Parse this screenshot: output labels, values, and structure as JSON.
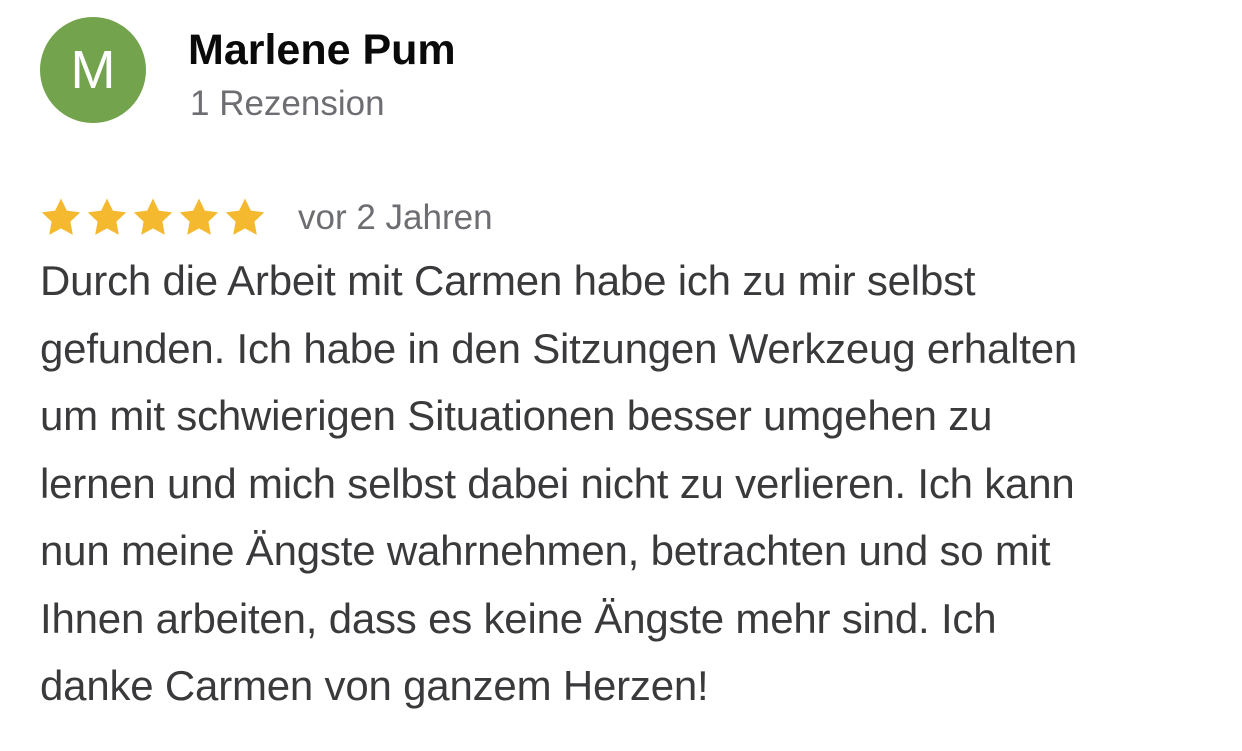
{
  "reviewer": {
    "initial": "M",
    "name": "Marlene Pum",
    "review_count": "1 Rezension",
    "avatar_color": "#73a34c"
  },
  "review": {
    "rating": 5,
    "rating_max": 5,
    "star_color": "#f4b92f",
    "date": "vor 2 Jahren",
    "lines": [
      "Durch die Arbeit mit Carmen habe ich zu mir selbst",
      "gefunden. Ich habe in den Sitzungen Werkzeug erhalten",
      "um mit schwierigen Situationen besser umgehen zu",
      "lernen und mich selbst dabei nicht zu verlieren. Ich kann",
      "nun meine Ängste wahrnehmen, betrachten und so mit",
      "Ihnen arbeiten, dass es keine Ängste mehr sind. Ich",
      "danke Carmen von ganzem Herzen!"
    ]
  }
}
